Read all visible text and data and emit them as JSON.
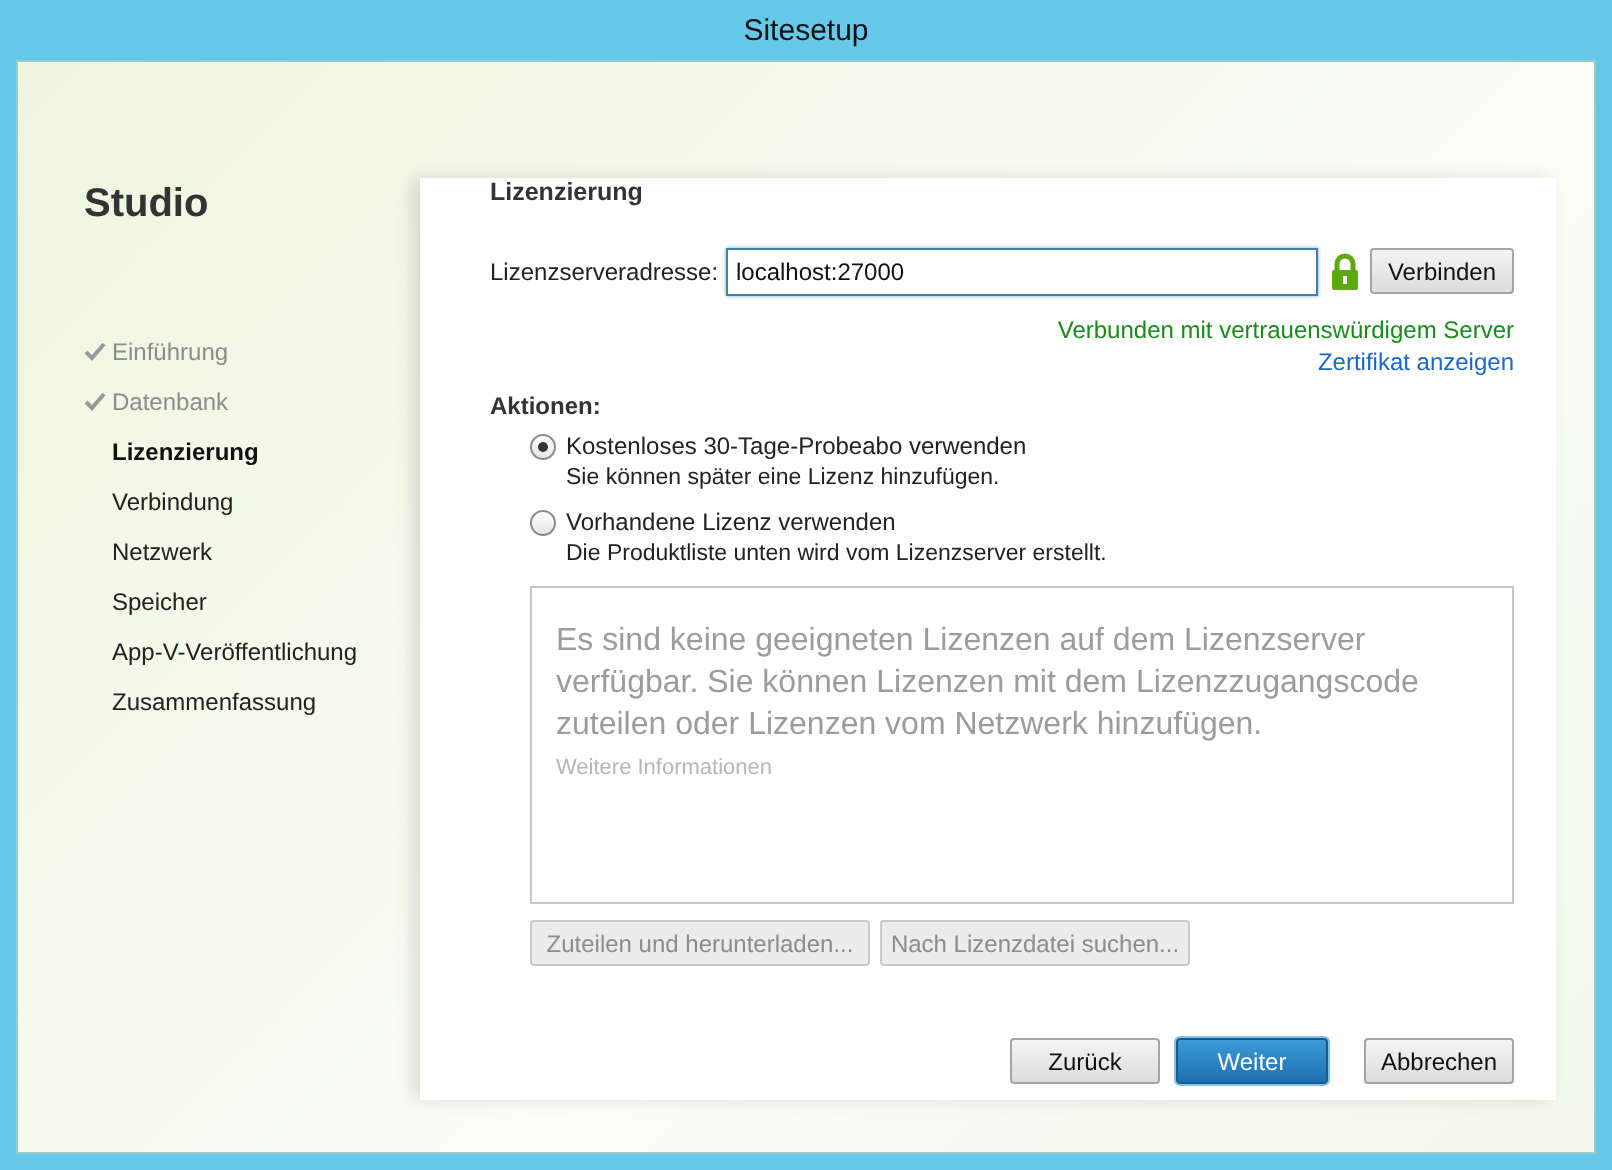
{
  "window": {
    "title": "Sitesetup"
  },
  "sidebar": {
    "title": "Studio",
    "steps": [
      {
        "label": "Einführung",
        "completed": true,
        "selected": false
      },
      {
        "label": "Datenbank",
        "completed": true,
        "selected": false
      },
      {
        "label": "Lizenzierung",
        "completed": false,
        "selected": true
      },
      {
        "label": "Verbindung",
        "completed": false,
        "selected": false
      },
      {
        "label": "Netzwerk",
        "completed": false,
        "selected": false
      },
      {
        "label": "Speicher",
        "completed": false,
        "selected": false
      },
      {
        "label": "App-V-Veröffentlichung",
        "completed": false,
        "selected": false
      },
      {
        "label": "Zusammenfassung",
        "completed": false,
        "selected": false
      }
    ]
  },
  "page": {
    "heading": "Lizenzierung",
    "server_label": "Lizenzserveradresse:",
    "server_value": "localhost:27000",
    "secure": true,
    "connect_button": "Verbinden",
    "status": "Verbunden mit vertrauenswürdigem Server",
    "certificate_link": "Zertifikat anzeigen",
    "actions_label": "Aktionen:",
    "options": [
      {
        "label": "Kostenloses 30-Tage-Probeabo verwenden",
        "hint": "Sie können später eine Lizenz hinzufügen.",
        "selected": true
      },
      {
        "label": "Vorhandene Lizenz verwenden",
        "hint": "Die Produktliste unten wird vom Lizenzserver erstellt.",
        "selected": false
      }
    ],
    "license_box": {
      "message": "Es sind keine geeigneten Lizenzen auf dem Lizenzserver verfügbar. Sie können Lizenzen mit dem Lizenzzugangscode zuteilen oder Lizenzen vom Netzwerk hinzufügen.",
      "more_link": "Weitere Informationen",
      "disabled": true
    },
    "license_buttons": [
      {
        "label": "Zuteilen und herunterladen...",
        "disabled": true
      },
      {
        "label": "Nach Lizenzdatei suchen...",
        "disabled": true
      }
    ]
  },
  "footer_buttons": [
    {
      "label": "Zurück",
      "kind": "default"
    },
    {
      "label": "Weiter",
      "kind": "primary"
    },
    {
      "label": "Abbrechen",
      "kind": "default"
    }
  ]
}
